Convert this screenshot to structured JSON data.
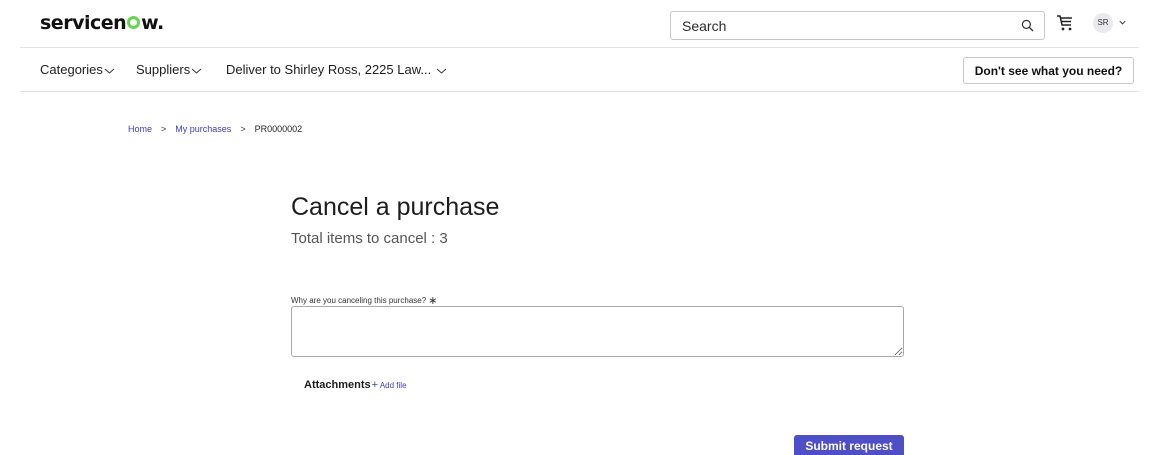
{
  "header": {
    "logo_text": "servicenow.",
    "search": {
      "placeholder": "Search"
    },
    "avatar_initials": "SR"
  },
  "nav": {
    "items": [
      {
        "label": "Categories"
      },
      {
        "label": "Suppliers"
      },
      {
        "label": "Deliver to Shirley Ross, 2225 Law..."
      }
    ],
    "help_button": "Don't see what you need?"
  },
  "breadcrumb": {
    "home": "Home",
    "sep": ">",
    "my_purchases": "My purchases",
    "current": "PR0000002"
  },
  "main": {
    "title": "Cancel a purchase",
    "subtitle": "Total items to cancel : 3",
    "reason_label": "Why are you canceling this purchase?",
    "required_mark": "∗",
    "reason_value": "",
    "attachments_label": "Attachments",
    "add_file_plus": "+",
    "add_file_label": "Add file",
    "submit_label": "Submit request"
  },
  "colors": {
    "accent": "#4e4ec7",
    "link": "#3b41b5",
    "brand_green": "#62d84e"
  }
}
